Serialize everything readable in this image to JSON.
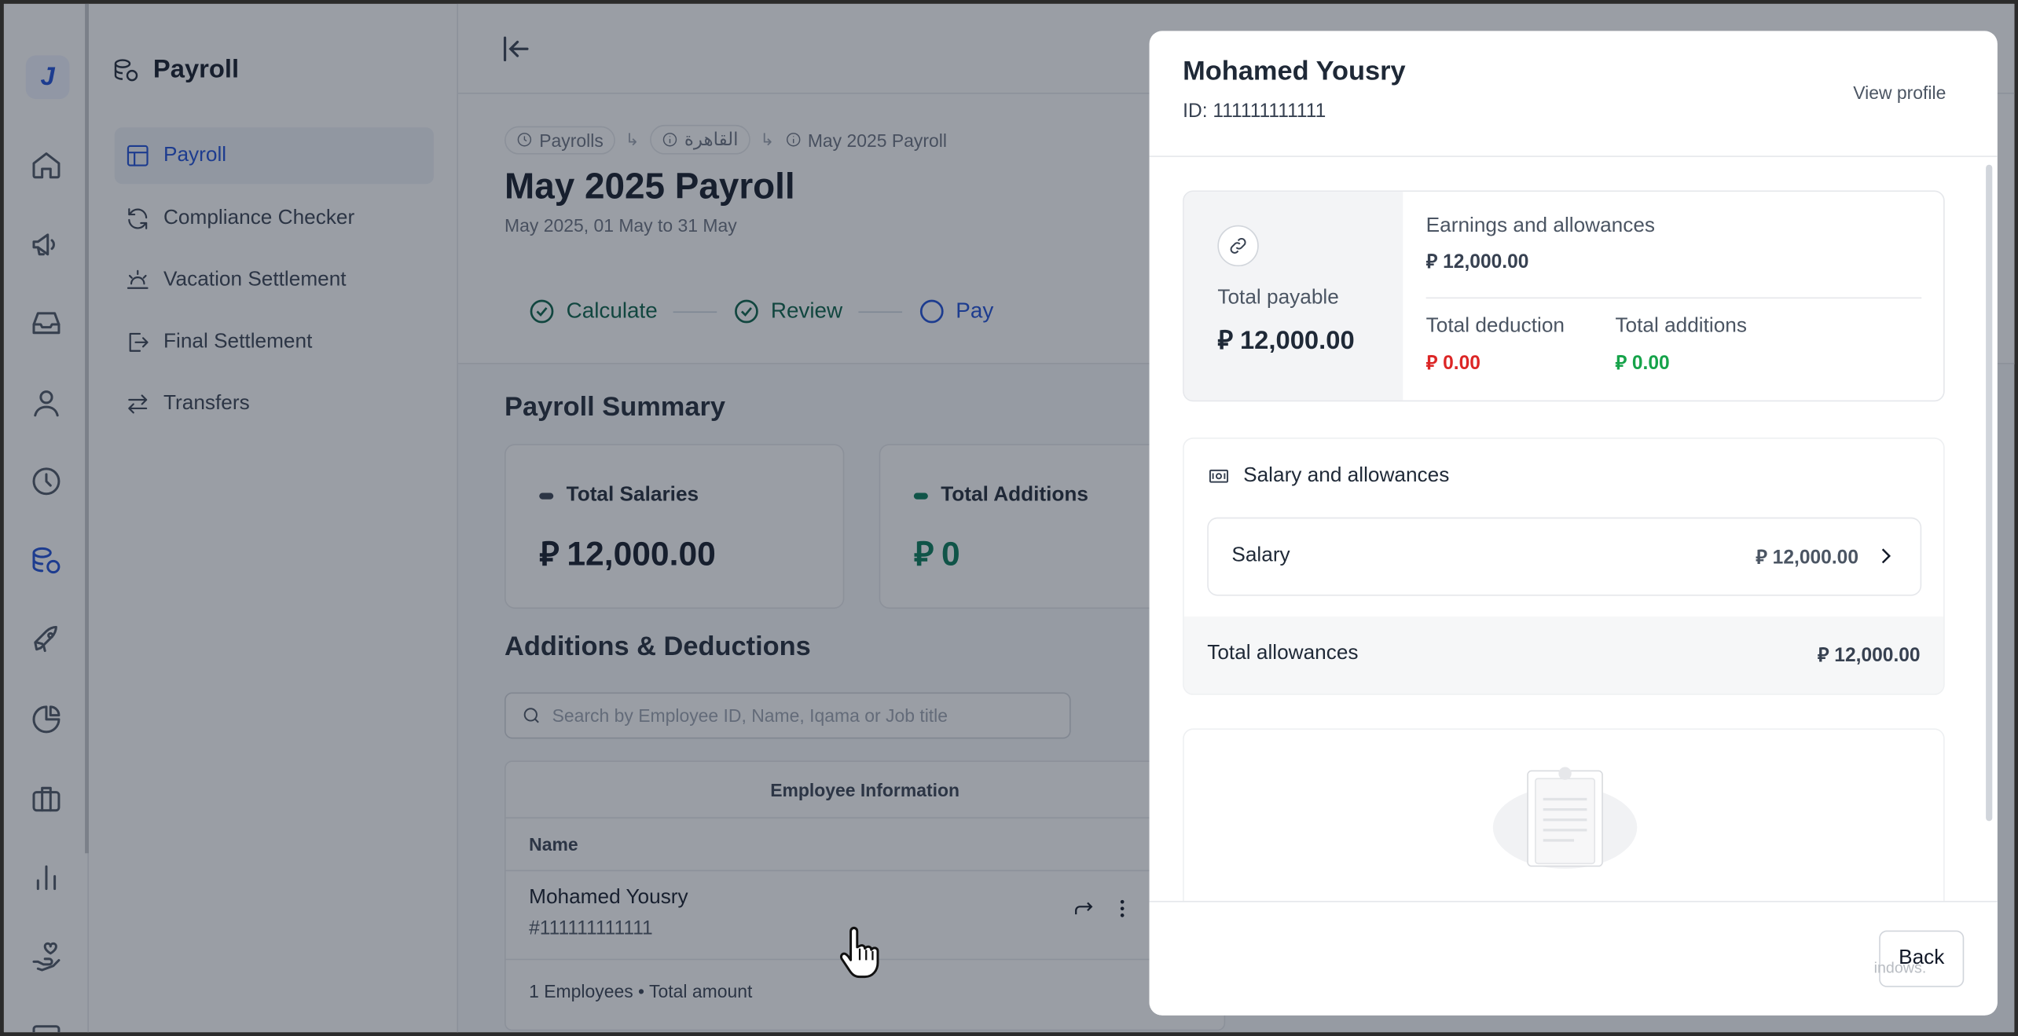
{
  "sidebar": {
    "logo": "J",
    "title": "Payroll",
    "items": [
      {
        "label": "Payroll"
      },
      {
        "label": "Compliance Checker"
      },
      {
        "label": "Vacation Settlement"
      },
      {
        "label": "Final Settlement"
      },
      {
        "label": "Transfers"
      }
    ]
  },
  "breadcrumb": {
    "items": [
      "Payrolls",
      "القاهرة",
      "May 2025 Payroll"
    ]
  },
  "page": {
    "title": "May 2025 Payroll",
    "subtitle": "May 2025, 01 May to 31 May"
  },
  "steps": [
    "Calculate",
    "Review",
    "Pay"
  ],
  "summary": {
    "title": "Payroll Summary",
    "cards": [
      {
        "label": "Total Salaries",
        "value": "12,000.00"
      },
      {
        "label": "Total Additions",
        "value": "0"
      }
    ]
  },
  "additions": {
    "title": "Additions & Deductions",
    "search_placeholder": "Search by Employee ID, Name, Iqama or Job title",
    "group_header": "Employee Information",
    "column_name": "Name",
    "rows": [
      {
        "name": "Mohamed Yousry",
        "id": "#111111111111"
      }
    ],
    "footer": "1 Employees • Total amount"
  },
  "drawer": {
    "name": "Mohamed Yousry",
    "id": "ID: 111111111111",
    "view_profile": "View profile",
    "total_payable_label": "Total payable",
    "total_payable_value": "12,000.00",
    "earnings_label": "Earnings and allowances",
    "earnings_value": "12,000.00",
    "deduction_label": "Total deduction",
    "deduction_value": "0.00",
    "additions_label": "Total additions",
    "additions_value": "0.00",
    "salary_section_title": "Salary and allowances",
    "salary_label": "Salary",
    "salary_value": "12,000.00",
    "total_allowances_label": "Total allowances",
    "total_allowances_value": "12,000.00",
    "back_label": "Back"
  },
  "currency_symbol": "⃁",
  "watermark": "indows.",
  "colors": {
    "accent": "#1d4ed8",
    "success": "#16a34a",
    "danger": "#dc2626",
    "step_done": "#065f46"
  }
}
